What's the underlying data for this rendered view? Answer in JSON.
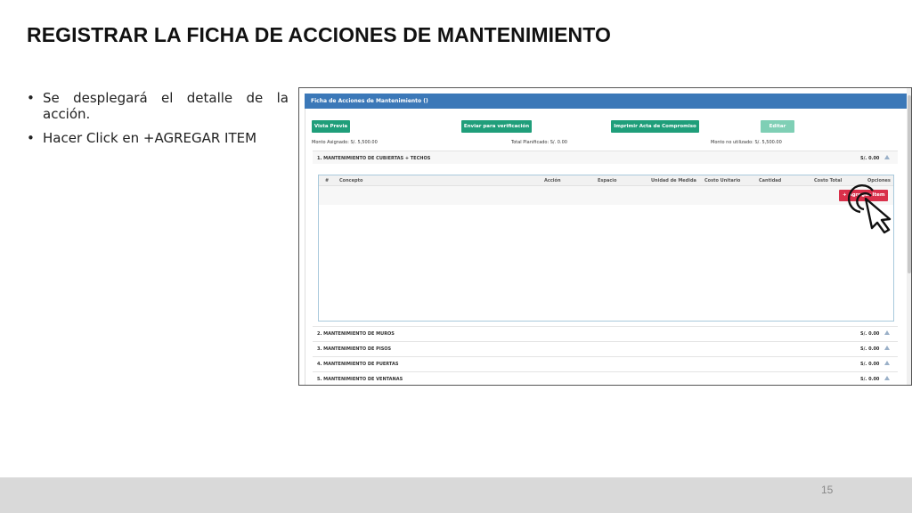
{
  "slide": {
    "title": "REGISTRAR LA FICHA DE ACCIONES DE MANTENIMIENTO",
    "bullets": [
      "Se desplegará el detalle de la acción.",
      "Hacer Click en +AGREGAR ITEM"
    ],
    "page_number": "15"
  },
  "app": {
    "card_title": "Ficha de Acciones de Mantenimiento ()",
    "buttons": {
      "preview": "Vista Previa",
      "send": "Enviar para verificación",
      "print": "Imprimir Acta de Compromiso",
      "edit": "Editar"
    },
    "amounts": {
      "assigned": "Monto Asignado: S/. 5,500.00",
      "planned": "Total Planificado: S/. 0.00",
      "unused": "Monto no utilizado: S/. 5,500.00"
    },
    "table_columns": [
      "#",
      "Concepto",
      "Acción",
      "Espacio",
      "Unidad de Medida",
      "Costo Unitario",
      "Cantidad",
      "Costo Total",
      "Opciones"
    ],
    "add_item_label": "+ Agregar Item",
    "sections": [
      {
        "label": "1. MANTENIMIENTO DE CUBIERTAS + TECHOS",
        "amount": "S/. 0.00"
      },
      {
        "label": "2. MANTENIMIENTO DE MUROS",
        "amount": "S/. 0.00"
      },
      {
        "label": "3. MANTENIMIENTO DE PISOS",
        "amount": "S/. 0.00"
      },
      {
        "label": "4. MANTENIMIENTO DE PUERTAS",
        "amount": "S/. 0.00"
      },
      {
        "label": "5. MANTENIMIENTO DE VENTANAS",
        "amount": "S/. 0.00"
      }
    ]
  },
  "colors": {
    "header_blue": "#3b78b8",
    "button_green": "#1f9e7a",
    "button_green_disabled": "#7fcfb5",
    "add_red": "#d9304a"
  },
  "icons": {
    "section_toggle": "chevron-up-icon",
    "cursor": "hand-pointer-click-icon"
  }
}
